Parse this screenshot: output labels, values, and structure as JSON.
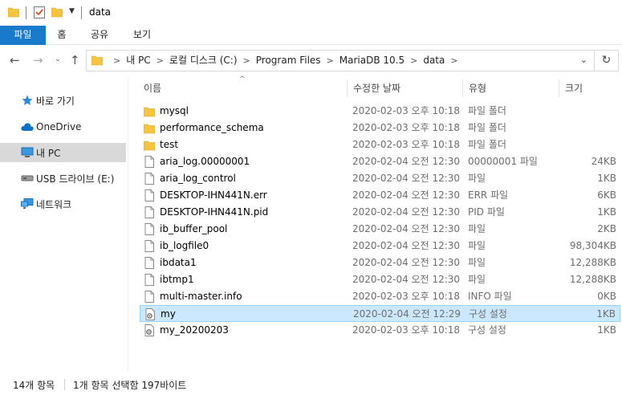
{
  "titlebar": {
    "title": "data"
  },
  "ribbon": {
    "tabs": [
      {
        "label": "파일"
      },
      {
        "label": "홈"
      },
      {
        "label": "공유"
      },
      {
        "label": "보기"
      }
    ]
  },
  "address": {
    "crumbs": [
      "내 PC",
      "로컬 디스크 (C:)",
      "Program Files",
      "MariaDB 10.5",
      "data"
    ]
  },
  "navpane": {
    "items": [
      {
        "label": "바로 가기",
        "icon": "star-icon"
      },
      {
        "label": "OneDrive",
        "icon": "cloud-icon"
      },
      {
        "label": "내 PC",
        "icon": "computer-icon"
      },
      {
        "label": "USB 드라이브 (E:)",
        "icon": "usb-drive-icon"
      },
      {
        "label": "네트워크",
        "icon": "network-icon"
      }
    ]
  },
  "columns": {
    "name": "이름",
    "date": "수정한 날짜",
    "type": "유형",
    "size": "크기"
  },
  "files": [
    {
      "name": "mysql",
      "date": "2020-02-03 오후 10:18",
      "type": "파일 폴더",
      "size": "",
      "icon": "folder"
    },
    {
      "name": "performance_schema",
      "date": "2020-02-03 오후 10:18",
      "type": "파일 폴더",
      "size": "",
      "icon": "folder"
    },
    {
      "name": "test",
      "date": "2020-02-03 오후 10:18",
      "type": "파일 폴더",
      "size": "",
      "icon": "folder"
    },
    {
      "name": "aria_log.00000001",
      "date": "2020-02-04 오전 12:30",
      "type": "00000001 파일",
      "size": "24KB",
      "icon": "file"
    },
    {
      "name": "aria_log_control",
      "date": "2020-02-04 오전 12:30",
      "type": "파일",
      "size": "1KB",
      "icon": "file"
    },
    {
      "name": "DESKTOP-IHN441N.err",
      "date": "2020-02-04 오전 12:30",
      "type": "ERR 파일",
      "size": "6KB",
      "icon": "file"
    },
    {
      "name": "DESKTOP-IHN441N.pid",
      "date": "2020-02-04 오전 12:30",
      "type": "PID 파일",
      "size": "1KB",
      "icon": "file"
    },
    {
      "name": "ib_buffer_pool",
      "date": "2020-02-04 오전 12:30",
      "type": "파일",
      "size": "2KB",
      "icon": "file"
    },
    {
      "name": "ib_logfile0",
      "date": "2020-02-04 오전 12:30",
      "type": "파일",
      "size": "98,304KB",
      "icon": "file"
    },
    {
      "name": "ibdata1",
      "date": "2020-02-04 오전 12:30",
      "type": "파일",
      "size": "12,288KB",
      "icon": "file"
    },
    {
      "name": "ibtmp1",
      "date": "2020-02-04 오전 12:30",
      "type": "파일",
      "size": "12,288KB",
      "icon": "file"
    },
    {
      "name": "multi-master.info",
      "date": "2020-02-03 오후 10:18",
      "type": "INFO 파일",
      "size": "0KB",
      "icon": "file"
    },
    {
      "name": "my",
      "date": "2020-02-04 오전 12:29",
      "type": "구성 설정",
      "size": "1KB",
      "icon": "config",
      "selected": true
    },
    {
      "name": "my_20200203",
      "date": "2020-02-03 오후 10:18",
      "type": "구성 설정",
      "size": "1KB",
      "icon": "config"
    }
  ],
  "status": {
    "count": "14개 항목",
    "selection": "1개 항목 선택함 197바이트"
  },
  "colors": {
    "accent": "#1979ca",
    "selection": "#cce8ff",
    "selection_border": "#99d1ff",
    "folder": "#f5c542"
  }
}
